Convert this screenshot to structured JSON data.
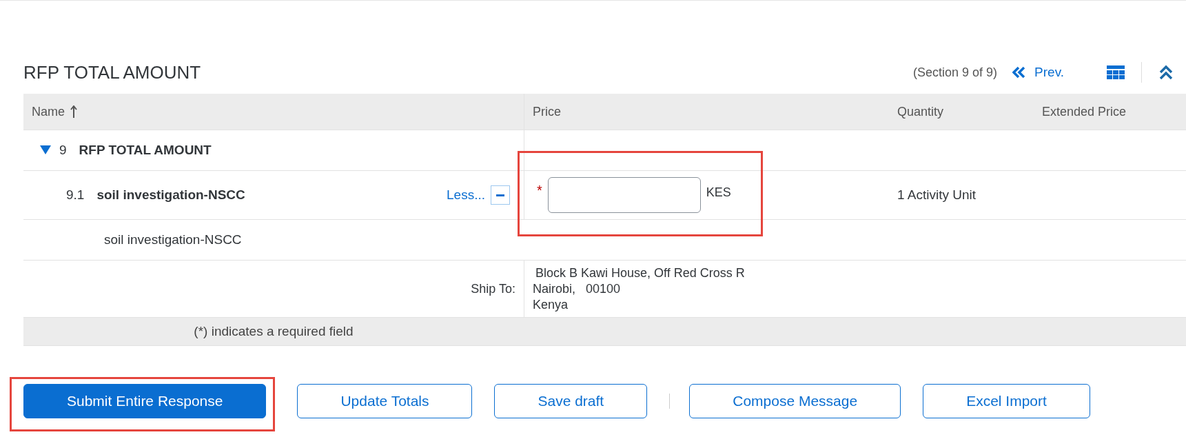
{
  "section": {
    "title": "RFP TOTAL AMOUNT",
    "position": "(Section 9 of 9)",
    "prev_link": "Prev."
  },
  "table": {
    "columns": [
      {
        "label": "Name",
        "sorted": true
      },
      {
        "label": "Price",
        "sorted": false
      },
      {
        "label": "Quantity",
        "sorted": false
      },
      {
        "label": "Extended Price",
        "sorted": false
      }
    ],
    "group": {
      "number": "9",
      "title": "RFP TOTAL AMOUNT",
      "expanded": true
    },
    "item": {
      "number": "9.1",
      "name": "soil investigation-NSCC",
      "toggle_link": "Less...",
      "expanded": true,
      "price": {
        "required_mark": "*",
        "currency": "KES",
        "highlighted": true
      },
      "quantity": "1 Activity Unit",
      "description": "soil investigation-NSCC",
      "ship_to_label": "Ship To:",
      "ship_to_lines": [
        "Block B Kawi House, Off Red Cross R",
        "Nairobi,   00100",
        "Kenya"
      ]
    },
    "required_note": "(*) indicates a required field"
  },
  "buttons": [
    {
      "kind": "button",
      "label": "Submit Entire Response",
      "primary": true,
      "highlighted": true
    },
    {
      "kind": "button",
      "label": "Update Totals",
      "primary": false,
      "highlighted": false
    },
    {
      "kind": "button",
      "label": "Save draft",
      "primary": false,
      "highlighted": false
    },
    {
      "kind": "separator"
    },
    {
      "kind": "button",
      "label": "Compose Message",
      "primary": false,
      "highlighted": false
    },
    {
      "kind": "button",
      "label": "Excel Import",
      "primary": false,
      "highlighted": false
    }
  ]
}
